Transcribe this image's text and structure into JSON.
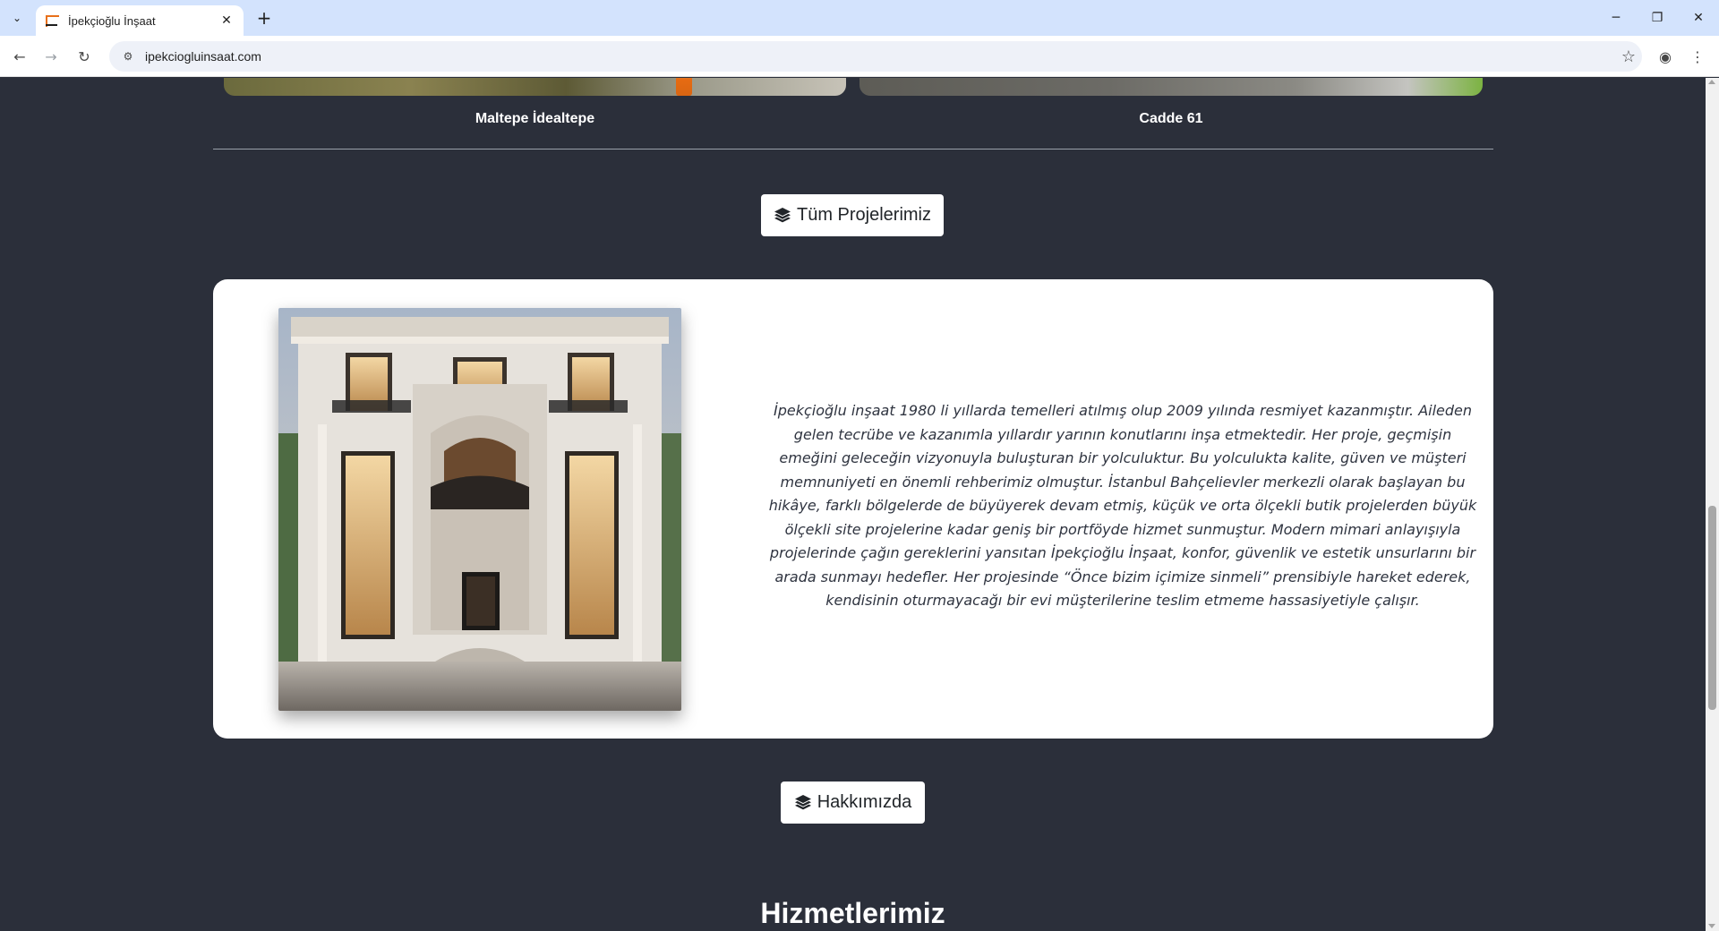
{
  "browser": {
    "tab_title": "İpekçioğlu İnşaat",
    "url": "ipekciogluinsaat.com"
  },
  "projects": [
    {
      "caption": "Maltepe İdealtepe"
    },
    {
      "caption": "Cadde 61"
    }
  ],
  "all_projects_button": {
    "label": "Tüm Projelerimiz",
    "icon": "layers-icon"
  },
  "about": {
    "text": "İpekçioğlu inşaat 1980 li yıllarda temelleri atılmış olup 2009 yılında resmiyet kazanmıştır. Aileden gelen tecrübe ve kazanımla yıllardır yarının konutlarını inşa etmektedir. Her proje, geçmişin emeğini geleceğin vizyonuyla buluşturan bir yolculuktur. Bu yolculukta kalite, güven ve müşteri memnuniyeti en önemli rehberimiz olmuştur. İstanbul Bahçelievler merkezli olarak başlayan bu hikâye, farklı bölgelerde de büyüyerek devam etmiş, küçük ve orta ölçekli butik projelerden büyük ölçekli site projelerine kadar geniş bir portföyde hizmet sunmuştur. Modern mimari anlayışıyla projelerinde çağın gereklerini yansıtan İpekçioğlu İnşaat, konfor, güvenlik ve estetik unsurlarını bir arada sunmayı hedefler. Her projesinde “Önce bizim içimize sinmeli” prensibiyle hareket ederek, kendisinin oturmayacağı bir evi müşterilerine teslim etmeme hassasiyetiyle çalışır."
  },
  "about_button": {
    "label": "Hakkımızda",
    "icon": "layers-icon"
  },
  "services": {
    "title": "Hizmetlerimiz"
  }
}
